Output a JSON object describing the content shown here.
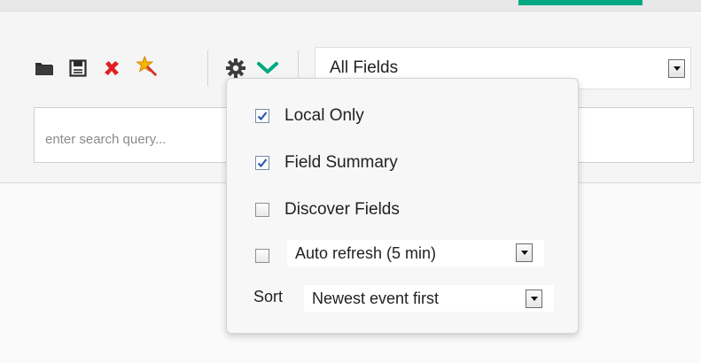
{
  "colors": {
    "accent": "#01a982",
    "check": "#2a57b5",
    "delete": "#e02020",
    "chevron": "#01a982"
  },
  "toolbar": {
    "icons": [
      "open-folder-icon",
      "save-disk-icon",
      "delete-x-icon",
      "new-star-wand-icon",
      "settings-gear-icon",
      "chevron-down-icon"
    ],
    "field_select": {
      "value": "All Fields"
    }
  },
  "search": {
    "placeholder": "enter search query...",
    "value": ""
  },
  "settings_menu": {
    "local_only": {
      "label": "Local Only",
      "checked": true
    },
    "field_summary": {
      "label": "Field Summary",
      "checked": true
    },
    "discover_fields": {
      "label": "Discover Fields",
      "checked": false
    },
    "auto_refresh": {
      "checked": false,
      "value": "Auto refresh (5 min)"
    },
    "sort": {
      "label": "Sort",
      "value": "Newest event first"
    }
  }
}
